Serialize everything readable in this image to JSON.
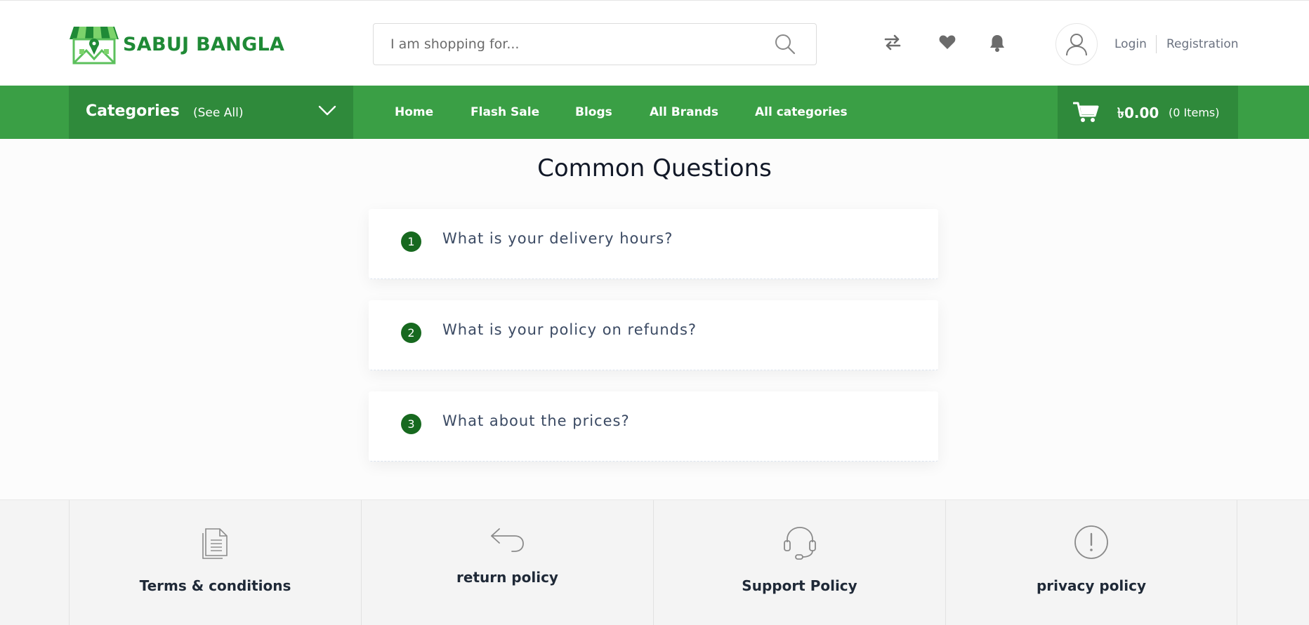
{
  "header": {
    "brand": "SABUJ BANGLA",
    "search_placeholder": "I am shopping for...",
    "icons": [
      "compare-icon",
      "heart-icon",
      "bell-icon",
      "user-icon"
    ],
    "login": "Login",
    "registration": "Registration"
  },
  "nav": {
    "categories_label": "Categories",
    "see_all": "(See All)",
    "links": [
      "Home",
      "Flash Sale",
      "Blogs",
      "All Brands",
      "All categories"
    ],
    "cart_amount": "৳0.00",
    "cart_items": "(0 Items)"
  },
  "faq": {
    "heading": "Common Questions",
    "items": [
      {
        "num": "1",
        "question": "What is your delivery hours?"
      },
      {
        "num": "2",
        "question": "What is your policy on refunds?"
      },
      {
        "num": "3",
        "question": "What about the prices?"
      }
    ]
  },
  "policies": [
    {
      "label": "Terms & conditions",
      "icon": "document-icon"
    },
    {
      "label": "return policy",
      "icon": "return-arrow-icon"
    },
    {
      "label": "Support Policy",
      "icon": "headset-icon"
    },
    {
      "label": "privacy policy",
      "icon": "exclamation-icon"
    }
  ],
  "colors": {
    "primary_green": "#3a9f45",
    "dark_green": "#2f8a3b",
    "number_badge": "#17691f"
  }
}
